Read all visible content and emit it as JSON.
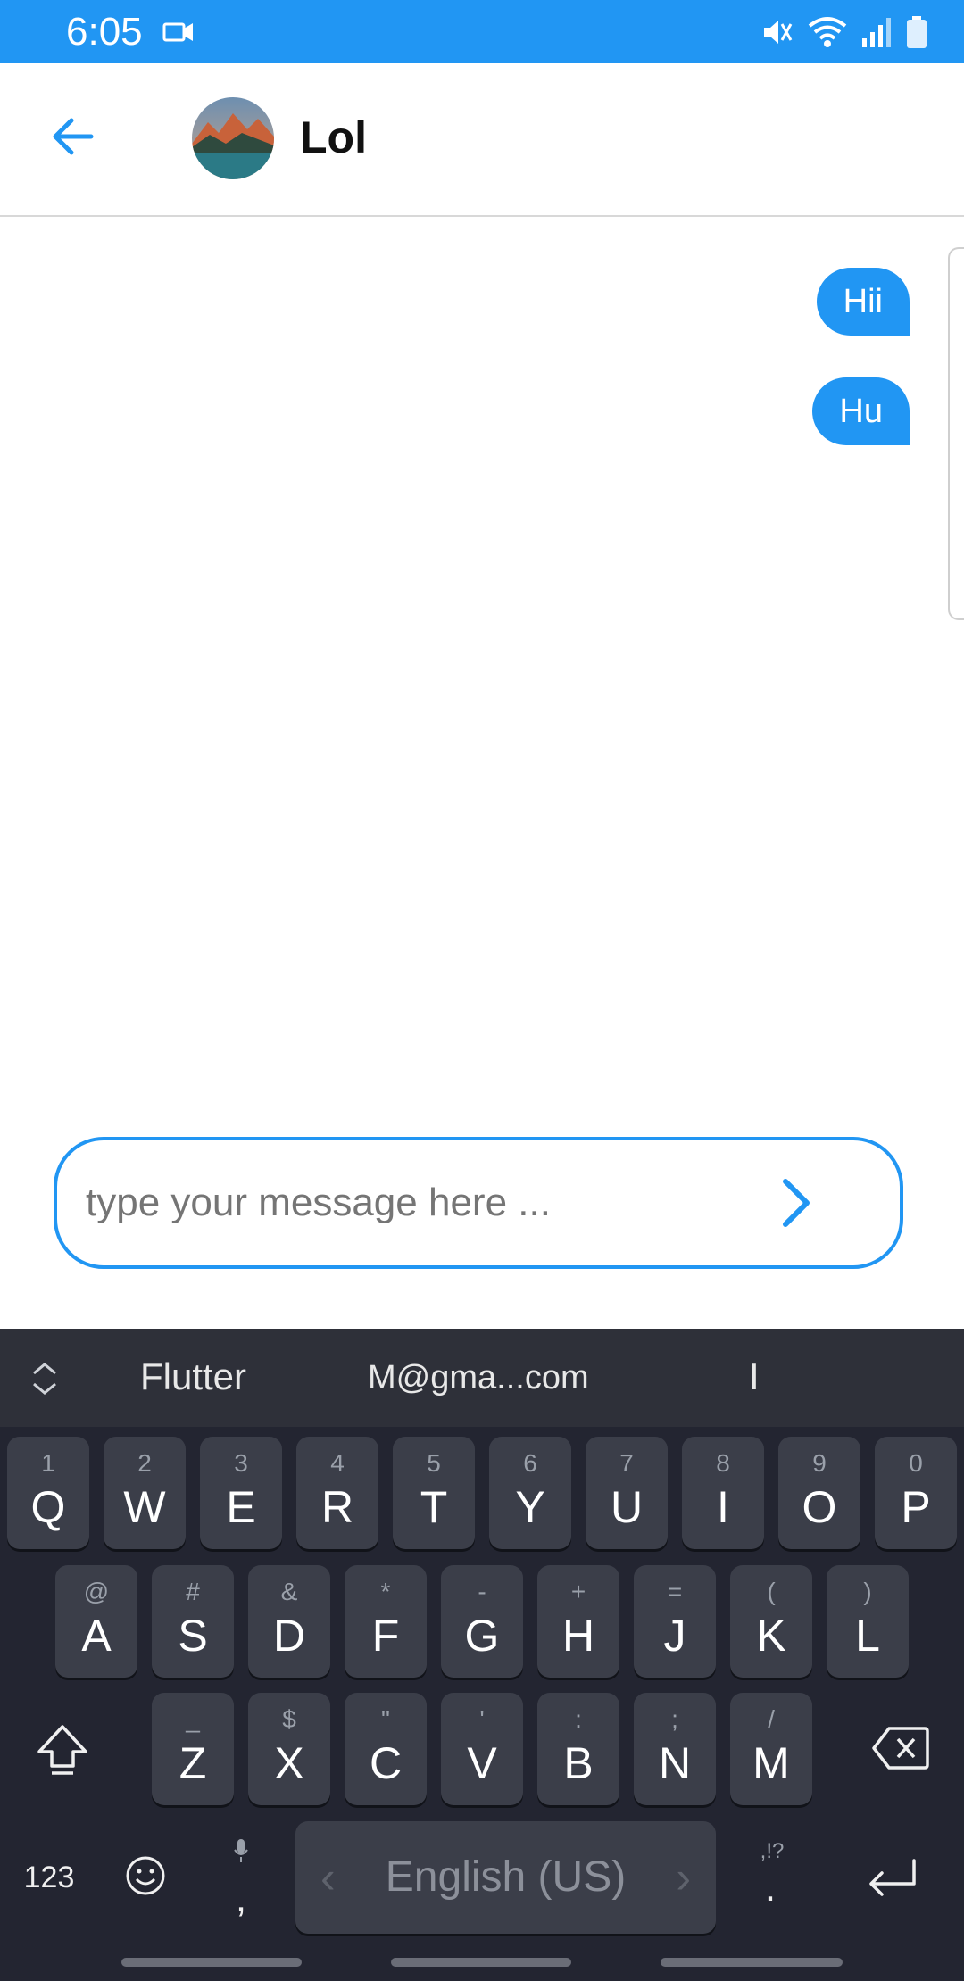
{
  "status_bar": {
    "time": "6:05",
    "icons": [
      "video-icon",
      "mute-icon",
      "wifi-icon",
      "signal-icon",
      "battery-icon"
    ],
    "background": "#2196f3"
  },
  "app_bar": {
    "title": "Lol",
    "back_icon": "arrow-back-icon"
  },
  "messages": [
    {
      "text": "Hii",
      "sender": "me"
    },
    {
      "text": "Hu",
      "sender": "me"
    }
  ],
  "composer": {
    "placeholder": "type your message here ...",
    "value": "",
    "send_icon": "chevron-right-icon"
  },
  "keyboard": {
    "suggestions": [
      "Flutter",
      "M@gma...com",
      "I"
    ],
    "rows": [
      [
        {
          "label": "Q",
          "hint": "1"
        },
        {
          "label": "W",
          "hint": "2"
        },
        {
          "label": "E",
          "hint": "3"
        },
        {
          "label": "R",
          "hint": "4"
        },
        {
          "label": "T",
          "hint": "5"
        },
        {
          "label": "Y",
          "hint": "6"
        },
        {
          "label": "U",
          "hint": "7"
        },
        {
          "label": "I",
          "hint": "8"
        },
        {
          "label": "O",
          "hint": "9"
        },
        {
          "label": "P",
          "hint": "0"
        }
      ],
      [
        {
          "label": "A",
          "hint": "@"
        },
        {
          "label": "S",
          "hint": "#"
        },
        {
          "label": "D",
          "hint": "&"
        },
        {
          "label": "F",
          "hint": "*"
        },
        {
          "label": "G",
          "hint": "-"
        },
        {
          "label": "H",
          "hint": "+"
        },
        {
          "label": "J",
          "hint": "="
        },
        {
          "label": "K",
          "hint": "("
        },
        {
          "label": "L",
          "hint": ")"
        }
      ],
      [
        {
          "label": "Z",
          "hint": "_"
        },
        {
          "label": "X",
          "hint": "$"
        },
        {
          "label": "C",
          "hint": "\""
        },
        {
          "label": "V",
          "hint": "'"
        },
        {
          "label": "B",
          "hint": ":"
        },
        {
          "label": "N",
          "hint": ";"
        },
        {
          "label": "M",
          "hint": "/"
        }
      ]
    ],
    "numbers_label": "123",
    "comma_label": ",",
    "space_label": "English (US)",
    "period_label": ".",
    "period_hint": ",!?"
  }
}
